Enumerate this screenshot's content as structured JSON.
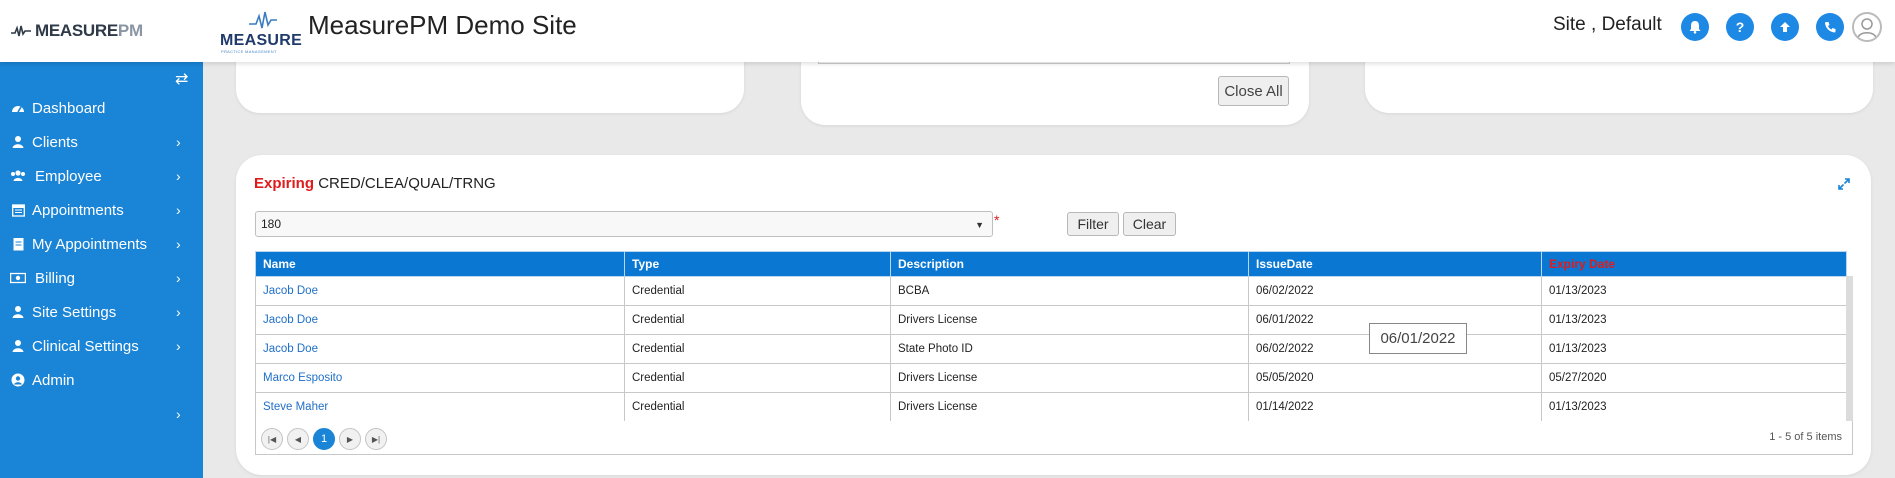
{
  "header": {
    "brand_word": "MEASURE",
    "brand_pm": "PM",
    "logo_text": "MEASURE",
    "logo_sub": "PRACTICE MANAGEMENT",
    "site_title": "MeasurePM Demo Site",
    "site_name": "Site , Default",
    "icons": [
      "bell-icon",
      "help-icon",
      "upload-icon",
      "phone-icon",
      "user-avatar-icon"
    ],
    "accent_color": "#1e88e5"
  },
  "sidebar": {
    "bg_color": "#1a84d6",
    "items": [
      {
        "label": "Dashboard",
        "icon": "dashboard-icon",
        "has_chevron": false
      },
      {
        "label": "Clients",
        "icon": "user-icon",
        "has_chevron": true
      },
      {
        "label": "Employee",
        "icon": "users-icon",
        "has_chevron": true
      },
      {
        "label": "Appointments",
        "icon": "calendar-icon",
        "has_chevron": true
      },
      {
        "label": "My Appointments",
        "icon": "clipboard-icon",
        "has_chevron": true
      },
      {
        "label": "Billing",
        "icon": "money-icon",
        "has_chevron": true
      },
      {
        "label": "Site Settings",
        "icon": "user-icon",
        "has_chevron": true
      },
      {
        "label": "Clinical Settings",
        "icon": "user-icon",
        "has_chevron": true
      },
      {
        "label": "Admin",
        "icon": "user-circle-icon",
        "has_chevron": false
      }
    ]
  },
  "top_cards": {
    "close_all_label": "Close All"
  },
  "expiring": {
    "title_highlight": "Expiring",
    "title_rest": "CRED/CLEA/QUAL/TRNG",
    "select_value": "180",
    "required_mark": "*",
    "filter_label": "Filter",
    "clear_label": "Clear",
    "columns": [
      "Name",
      "Type",
      "Description",
      "IssueDate",
      "Expiry Date"
    ],
    "rows": [
      {
        "name": "Jacob Doe",
        "type": "Credential",
        "description": "BCBA",
        "issue": "06/02/2022",
        "expiry": "01/13/2023"
      },
      {
        "name": "Jacob Doe",
        "type": "Credential",
        "description": "Drivers License",
        "issue": "06/01/2022",
        "expiry": "01/13/2023"
      },
      {
        "name": "Jacob Doe",
        "type": "Credential",
        "description": "State Photo ID",
        "issue": "06/02/2022",
        "expiry": "01/13/2023"
      },
      {
        "name": "Marco Esposito",
        "type": "Credential",
        "description": "Drivers License",
        "issue": "05/05/2020",
        "expiry": "05/27/2020"
      },
      {
        "name": "Steve Maher",
        "type": "Credential",
        "description": "Drivers License",
        "issue": "01/14/2022",
        "expiry": "01/13/2023"
      }
    ],
    "tooltip": "06/01/2022",
    "pager": {
      "current_page": "1",
      "info": "1 - 5 of 5 items"
    }
  }
}
